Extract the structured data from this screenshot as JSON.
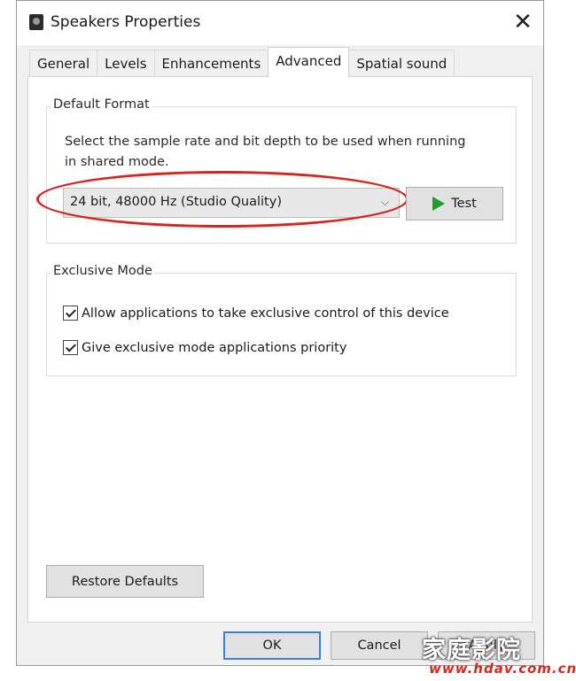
{
  "window": {
    "title": "Speakers Properties",
    "close_label": "✕"
  },
  "tabs": [
    {
      "label": "General"
    },
    {
      "label": "Levels"
    },
    {
      "label": "Enhancements"
    },
    {
      "label": "Advanced",
      "active": true
    },
    {
      "label": "Spatial sound"
    }
  ],
  "default_format": {
    "group_title": "Default Format",
    "description": "Select the sample rate and bit depth to be used when running in shared mode.",
    "selected_format": "24 bit, 48000 Hz (Studio Quality)",
    "test_label": "Test"
  },
  "exclusive_mode": {
    "group_title": "Exclusive Mode",
    "allow_exclusive_label": "Allow applications to take exclusive control of this device",
    "allow_exclusive_checked": true,
    "priority_label": "Give exclusive mode applications priority",
    "priority_checked": true
  },
  "buttons": {
    "restore_defaults": "Restore Defaults",
    "ok": "OK",
    "cancel": "Cancel",
    "apply": "Apply"
  },
  "watermark": {
    "text_cn": "家庭影院",
    "url": "www.hdav.com.cn"
  },
  "colors": {
    "highlight_ellipse": "#d9241b",
    "play_icon": "#1f9d2a"
  }
}
